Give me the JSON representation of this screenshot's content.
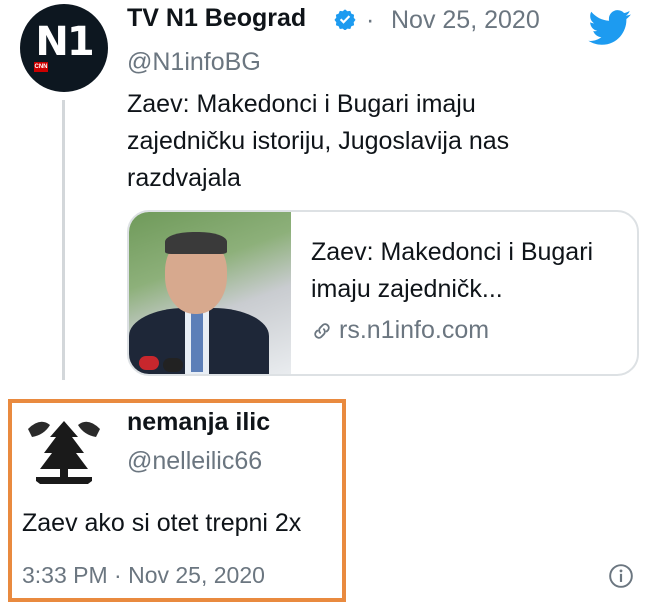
{
  "tweet": {
    "name": "TV N1 Beograd",
    "separator": "·",
    "date": "Nov 25, 2020",
    "handle": "@N1infoBG",
    "text": "Zaev: Makedonci i Bugari imaju zajedničku istoriju, Jugoslavija nas razdvajala",
    "avatar_logo": "N1",
    "card": {
      "title": "Zaev: Makedonci i Bugari imaju zajedničk...",
      "domain": "rs.n1info.com",
      "link_icon": "link-icon"
    }
  },
  "reply": {
    "name": "nemanja ilic",
    "handle": "@nelleilic66",
    "text": "Zaev ako si otet trepni 2x",
    "meta": "3:33 PM · Nov 25, 2020",
    "info_icon": "info-icon"
  },
  "colors": {
    "muted": "#6b7680",
    "verified": "#1d9bf0",
    "twitter_blue": "#1d9bf0",
    "highlight_border": "#e98a3f"
  }
}
